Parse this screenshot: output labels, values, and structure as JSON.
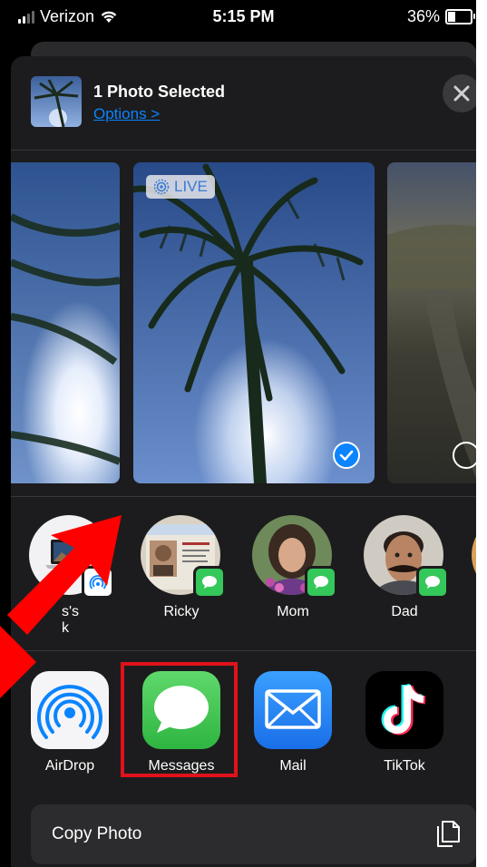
{
  "status_bar": {
    "carrier": "Verizon",
    "time": "5:15 PM",
    "battery": "36%"
  },
  "share_sheet": {
    "title": "1 Photo Selected",
    "options_link": "Options >",
    "close_icon": "close-icon",
    "live_badge": "LIVE",
    "people": [
      {
        "name": "s's\nk",
        "type": "airdrop-device"
      },
      {
        "name": "Ricky",
        "type": "messages-contact"
      },
      {
        "name": "Mom",
        "type": "messages-contact"
      },
      {
        "name": "Dad",
        "type": "messages-contact"
      }
    ],
    "apps": [
      {
        "label": "AirDrop",
        "icon": "airdrop-icon"
      },
      {
        "label": "Messages",
        "icon": "messages-icon"
      },
      {
        "label": "Mail",
        "icon": "mail-icon"
      },
      {
        "label": "TikTok",
        "icon": "tiktok-icon"
      }
    ],
    "actions": [
      {
        "label": "Copy Photo",
        "icon": "copy-icon"
      }
    ]
  },
  "colors": {
    "sheet_bg": "#1c1c1e",
    "link": "#0a84ff",
    "highlight": "#e0121b",
    "messages_green": "#34c759",
    "mail_blue": "#1e88f5"
  }
}
